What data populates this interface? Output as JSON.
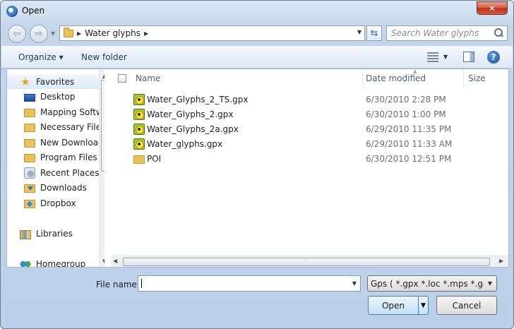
{
  "window": {
    "title": "Open",
    "close_symbol": "✕"
  },
  "address": {
    "crumb": "Water glyphs"
  },
  "search": {
    "placeholder": "Search Water glyphs"
  },
  "toolbar": {
    "organize": "Organize ▾",
    "new_folder": "New folder"
  },
  "nav": {
    "items": [
      {
        "label": "Favorites",
        "icon": "star-icon"
      },
      {
        "label": "Desktop",
        "icon": "desktop-icon"
      },
      {
        "label": "Mapping Software",
        "icon": "folder-icon"
      },
      {
        "label": "Necessary Files",
        "icon": "folder-icon"
      },
      {
        "label": "New Downloads",
        "icon": "folder-icon"
      },
      {
        "label": "Program Files",
        "icon": "folder-icon"
      },
      {
        "label": "Recent Places",
        "icon": "recent-places-icon"
      },
      {
        "label": "Downloads",
        "icon": "downloads-icon"
      },
      {
        "label": "Dropbox",
        "icon": "dropbox-icon"
      },
      {
        "label": "Libraries",
        "icon": "libraries-icon"
      },
      {
        "label": "Homegroup",
        "icon": "homegroup-icon"
      }
    ]
  },
  "columns": {
    "name": "Name",
    "date": "Date modified",
    "size": "Size"
  },
  "files": [
    {
      "name": "Water_Glyphs_2_TS.gpx",
      "date": "6/30/2010 2:28 PM",
      "icon": "gpx-file-icon"
    },
    {
      "name": "Water_Glyphs_2.gpx",
      "date": "6/30/2010 1:00 PM",
      "icon": "gpx-file-icon"
    },
    {
      "name": "Water_Glyphs_2a.gpx",
      "date": "6/29/2010 11:35 PM",
      "icon": "gpx-file-icon"
    },
    {
      "name": "Water_glyphs.gpx",
      "date": "6/29/2010 11:33 AM",
      "icon": "gpx-file-icon"
    },
    {
      "name": "POI",
      "date": "6/30/2010 12:51 PM",
      "icon": "folder-icon"
    }
  ],
  "footer": {
    "file_name_label": "File name:",
    "file_name_value": "",
    "filter": "Gps ( *.gpx *.loc *.mps *.gdb *.",
    "open": "Open",
    "cancel": "Cancel"
  }
}
